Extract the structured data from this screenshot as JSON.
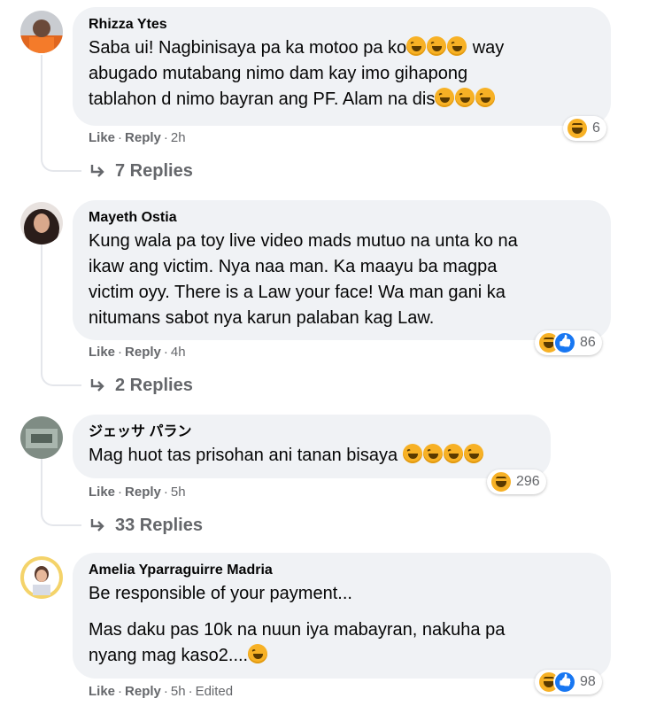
{
  "comments": [
    {
      "author": "Rhizza Ytes",
      "lines": [
        "Saba ui! Nagbinisaya pa ka motoo pa ko",
        "way",
        "abugado mutabang nimo dam kay imo gihapong",
        "tablahon d nimo bayran ang PF. Alam na dis"
      ],
      "reaction_count": "6",
      "like": "Like",
      "reply": "Reply",
      "time": "2h",
      "replies_label": "7 Replies"
    },
    {
      "author": "Mayeth Ostia",
      "lines": [
        "Kung wala pa toy live video mads mutuo na unta ko na",
        "ikaw ang victim. Nya naa man. Ka maayu ba magpa",
        "victim oyy. There is a Law your face! Wa man gani ka",
        "nitumans sabot nya karun palaban kag Law."
      ],
      "reaction_count": "86",
      "like": "Like",
      "reply": "Reply",
      "time": "4h",
      "replies_label": "2 Replies"
    },
    {
      "author": "ジェッサ パラン",
      "lines": [
        "Mag huot tas prisohan ani tanan bisaya"
      ],
      "reaction_count": "296",
      "like": "Like",
      "reply": "Reply",
      "time": "5h",
      "replies_label": "33 Replies"
    },
    {
      "author": "Amelia Yparraguirre Madria",
      "lines": [
        "Be responsible of your payment...",
        "Mas daku pas 10k na nuun iya mabayran, nakuha pa",
        "nyang mag kaso2...."
      ],
      "reaction_count": "98",
      "like": "Like",
      "reply": "Reply",
      "time": "5h",
      "edited": "Edited"
    }
  ],
  "colors": {
    "bubble": "#f0f2f5",
    "meta": "#65676b",
    "haha": "#f7b125",
    "like": "#1877f2"
  }
}
